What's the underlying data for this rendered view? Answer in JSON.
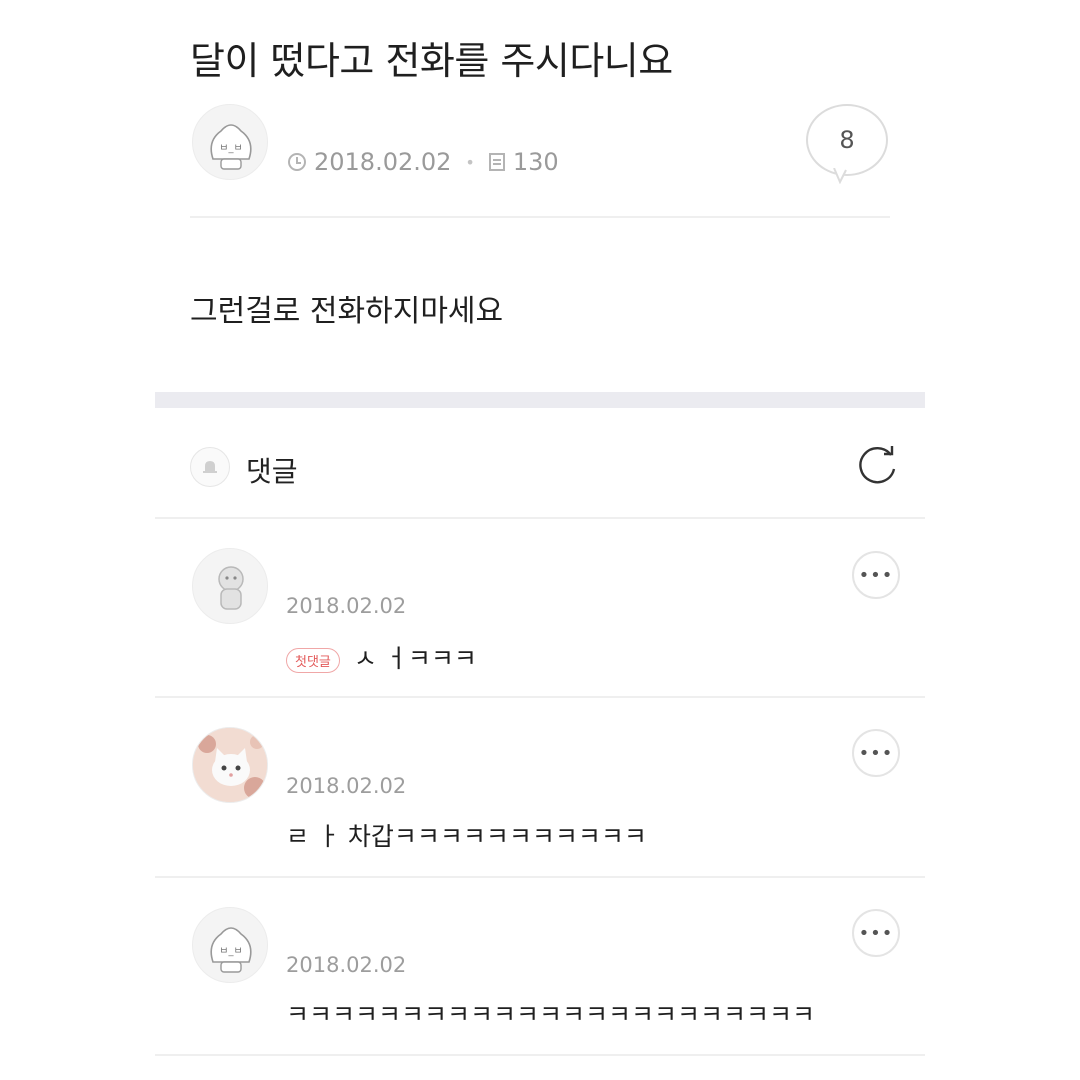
{
  "post": {
    "title": "달이 떴다고 전화를 주시다니요",
    "date": "2018.02.02",
    "views": "130",
    "comment_count": "8",
    "body": "그런걸로 전화하지마세요"
  },
  "comments_section": {
    "heading": "댓글"
  },
  "comments": [
    {
      "date": "2018.02.02",
      "badge": "첫댓글",
      "text": "ㅅ ㅓㅋㅋㅋ"
    },
    {
      "date": "2018.02.02",
      "text": "ㄹ ㅏ 차갑ㅋㅋㅋㅋㅋㅋㅋㅋㅋㅋㅋ"
    },
    {
      "date": "2018.02.02",
      "text": "ㅋㅋㅋㅋㅋㅋㅋㅋㅋㅋㅋㅋㅋㅋㅋㅋㅋㅋㅋㅋㅋㅋㅋ"
    }
  ],
  "icons": {
    "clock": "clock-icon",
    "views": "views-icon",
    "speech_bubble": "speech-bubble-icon",
    "bell": "bell-icon",
    "refresh": "refresh-icon",
    "more": "more-icon"
  },
  "colors": {
    "badge_red": "#e35a5a",
    "meta_gray": "#9a9a9a",
    "band": "#ebebf0"
  }
}
